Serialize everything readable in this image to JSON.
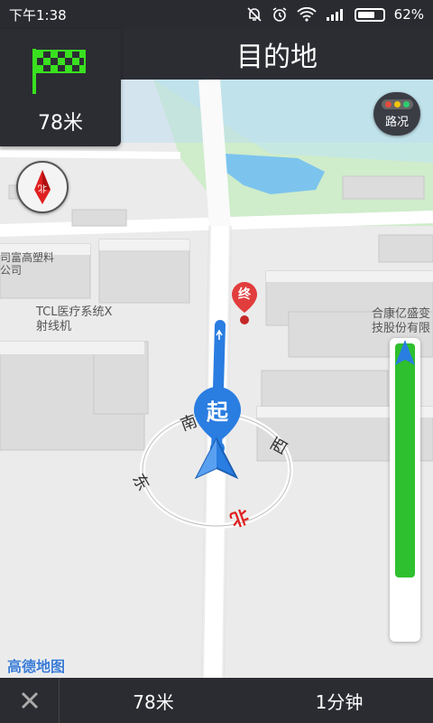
{
  "status_bar": {
    "time": "下午1:38",
    "battery": "62%"
  },
  "nav": {
    "destination_title": "目的地",
    "next_turn_distance": "78米",
    "turn_icon": "finish-flag-icon"
  },
  "map": {
    "traffic_label": "路况",
    "poi_labels": {
      "plastics_company": [
        "司富高塑料",
        "公司"
      ],
      "tcl": [
        "TCL医疗系统X",
        "射线机"
      ],
      "hekang": [
        "合康亿盛变",
        "技股份有限"
      ]
    },
    "end_marker": "终",
    "start_marker": "起",
    "compass": {
      "north": "北",
      "south": "南",
      "east": "东",
      "west": "西"
    },
    "route_progress": 0.9,
    "logo": "高德地图"
  },
  "bottom_bar": {
    "remaining_distance": "78米",
    "remaining_time": "1分钟"
  }
}
